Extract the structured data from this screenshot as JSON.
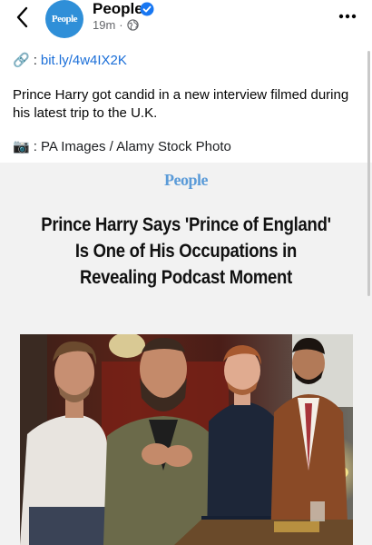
{
  "header": {
    "page_name": "People",
    "avatar_text": "People",
    "time": "19m",
    "separator": "·"
  },
  "post": {
    "link_emoji": "🔗",
    "link_suffix": ":",
    "link_text": "bit.ly/4w4IX2K",
    "caption": "Prince Harry got candid in a new interview filmed during his latest trip to the U.K.",
    "credit_emoji": "📷",
    "credit_text": ": PA Images / Alamy Stock Photo"
  },
  "card": {
    "brand": "People",
    "headline": "Prince Harry Says 'Prince of England' Is One of His Occupations in Revealing Podcast Moment"
  },
  "icons": {
    "back": "chevron-left-icon",
    "verified": "verified-badge-icon",
    "globe": "globe-icon",
    "more": "more-dots-icon"
  },
  "colors": {
    "accent_link": "#1a6ed8",
    "brand_blue": "#2f8fd8",
    "card_bg": "#f2f2f2"
  }
}
